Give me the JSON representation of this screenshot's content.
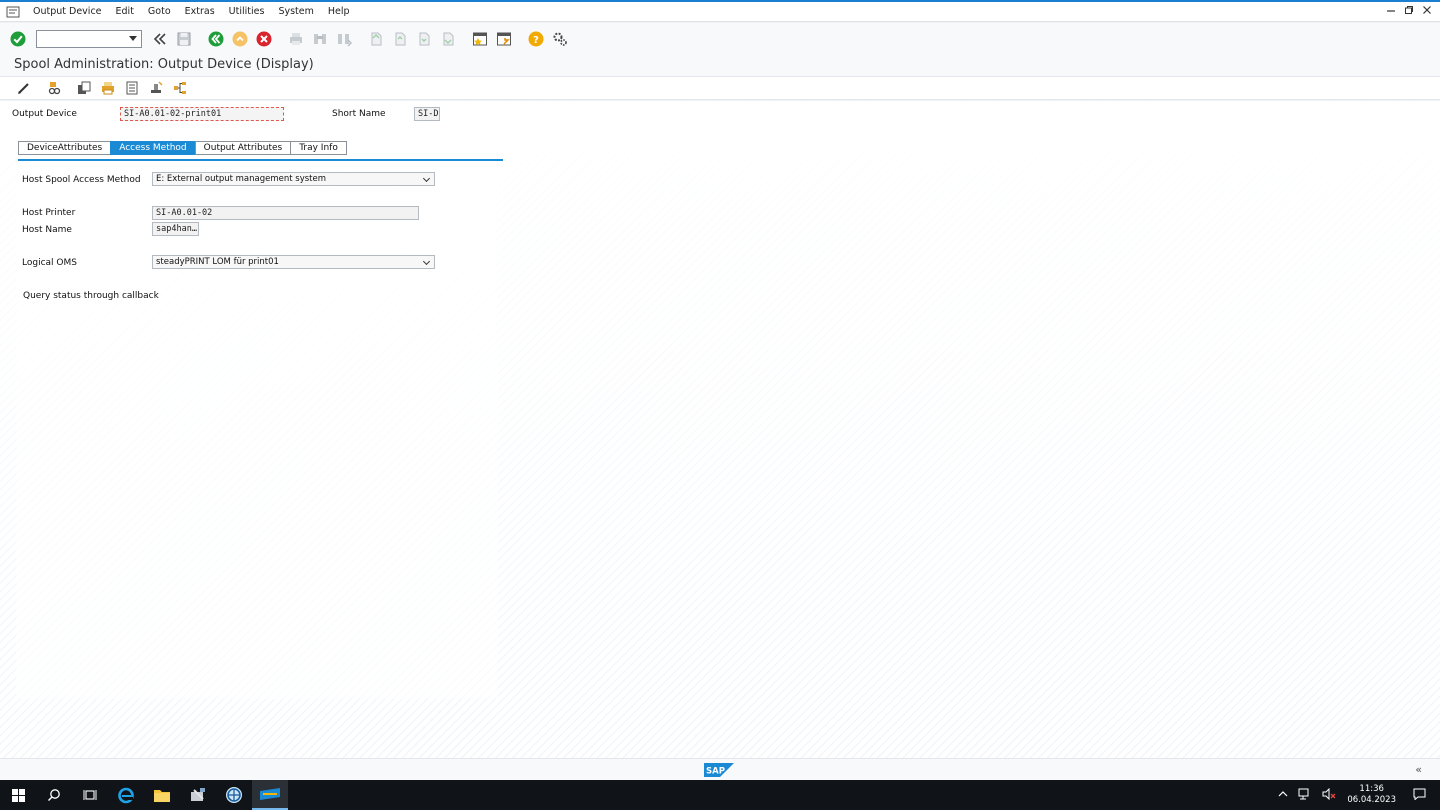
{
  "menubar": {
    "items": [
      "Output Device",
      "Edit",
      "Goto",
      "Extras",
      "Utilities",
      "System",
      "Help"
    ]
  },
  "toolbar": {
    "command_value": ""
  },
  "title": "Spool Administration: Output Device (Display)",
  "header": {
    "output_device_label": "Output Device",
    "output_device_value": "SI-A0.01-02-print01",
    "short_name_label": "Short Name",
    "short_name_value": "SI-D"
  },
  "tabs": [
    {
      "label": "DeviceAttributes"
    },
    {
      "label": "Access Method"
    },
    {
      "label": "Output Attributes"
    },
    {
      "label": "Tray Info"
    }
  ],
  "access_method": {
    "host_spool_label": "Host Spool Access Method",
    "host_spool_value": "E: External output management system",
    "host_printer_label": "Host Printer",
    "host_printer_value": "SI-A0.01-02",
    "host_name_label": "Host Name",
    "host_name_value": "sap4han…",
    "logical_oms_label": "Logical OMS",
    "logical_oms_value": "steadyPRINT LOM für print01",
    "query_status_text": "Query status through callback"
  },
  "statusbar": {
    "logo": "SAP",
    "chevron": "«"
  },
  "taskbar": {
    "time": "11:36",
    "date": "06.04.2023"
  },
  "colors": {
    "accent": "#1a8ad4",
    "taskbar": "#101418",
    "required_border": "#e0584d"
  }
}
